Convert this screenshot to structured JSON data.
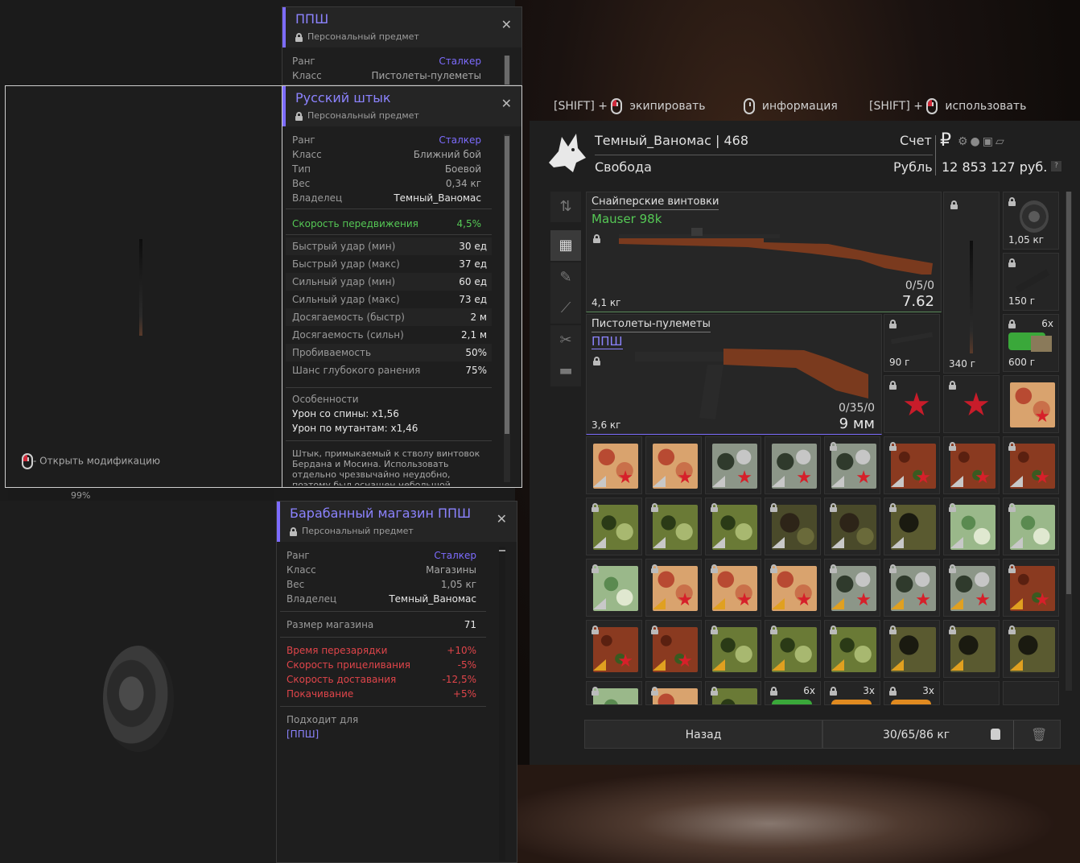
{
  "hints": {
    "equip_prefix": "[SHIFT] +",
    "equip": "экипировать",
    "info": "информация",
    "use_prefix": "[SHIFT] +",
    "use": "использовать"
  },
  "player": {
    "name": "Темный_Ваномас",
    "separator": "|",
    "level": "468",
    "faction": "Свобода",
    "account_label": "Счет",
    "currency_label": "Рубль",
    "balance": "12 853 127 руб.",
    "help": "?"
  },
  "items": {
    "rifle_category": "Снайперские винтовки",
    "rifle_name": "Mauser 98k",
    "rifle_weight": "4,1 кг",
    "rifle_ammo": "0/5/0",
    "rifle_caliber": "7.62",
    "smg_category": "Пистолеты-пулеметы",
    "smg_name": "ППШ",
    "smg_weight": "3,6 кг",
    "smg_ammo": "0/35/0",
    "smg_caliber": "9 мм",
    "bayonet_weight": "340 г",
    "mag_weight": "1,05 кг",
    "rail_weight": "150 г",
    "rail2_weight": "90 г",
    "box_weight": "600 г",
    "box_count": "6x",
    "bottom_count_1": "6x",
    "bottom_count_2": "3x",
    "bottom_count_3": "3x"
  },
  "footer": {
    "back": "Назад",
    "weight": "30/65/86 кг"
  },
  "tip_ppsh": {
    "title": "ППШ",
    "subtitle": "Персональный предмет",
    "rank_label": "Ранг",
    "rank": "Сталкер",
    "class_label": "Класс",
    "class": "Пистолеты-пулеметы"
  },
  "tip_bayonet": {
    "title": "Русский штык",
    "subtitle": "Персональный предмет",
    "rank_label": "Ранг",
    "rank": "Сталкер",
    "class_label": "Класс",
    "class": "Ближний бой",
    "type_label": "Тип",
    "type": "Боевой",
    "weight_label": "Вес",
    "weight": "0,34 кг",
    "owner_label": "Владелец",
    "owner": "Темный_Ваномас",
    "speed_label": "Скорость передвижения",
    "speed": "4,5%",
    "stats": [
      {
        "label": "Быстрый удар (мин)",
        "value": "30 ед"
      },
      {
        "label": "Быстрый удар (макс)",
        "value": "37 ед"
      },
      {
        "label": "Сильный удар (мин)",
        "value": "60 ед"
      },
      {
        "label": "Сильный удар (макс)",
        "value": "73 ед"
      },
      {
        "label": "Досягаемость (быстр)",
        "value": "2 м"
      },
      {
        "label": "Досягаемость (сильн)",
        "value": "2,1 м"
      },
      {
        "label": "Пробиваемость",
        "value": "50%"
      },
      {
        "label": "Шанс глубокого ранения",
        "value": "75%"
      }
    ],
    "features_label": "Особенности",
    "feature_1": "Урон со спины: x1,56",
    "feature_2": "Урон по мутантам: x1,46",
    "description": "Штык, примыкаемый к стволу винтовок Бердана и Мосина. Использовать отдельно чрезвычайно неудобно, поэтому был оснащен небольшой",
    "open_mod": "- Открыть модификацию"
  },
  "tip_drum": {
    "title": "Барабанный магазин ППШ",
    "subtitle": "Персональный предмет",
    "rank_label": "Ранг",
    "rank": "Сталкер",
    "class_label": "Класс",
    "class": "Магазины",
    "weight_label": "Вес",
    "weight": "1,05 кг",
    "owner_label": "Владелец",
    "owner": "Темный_Ваномас",
    "mag_size_label": "Размер магазина",
    "mag_size": "71",
    "penalties": [
      {
        "label": "Время перезарядки",
        "value": "+10%"
      },
      {
        "label": "Скорость прицеливания",
        "value": "-5%"
      },
      {
        "label": "Скорость доставания",
        "value": "-12,5%"
      },
      {
        "label": "Покачивание",
        "value": "+5%"
      }
    ],
    "fits_label": "Подходит для",
    "fits": "[ППШ]"
  },
  "misc": {
    "percent": "99%"
  }
}
